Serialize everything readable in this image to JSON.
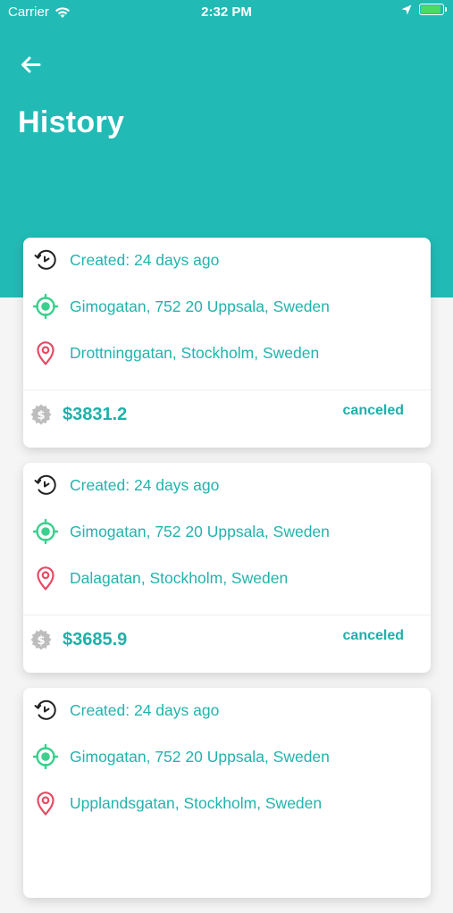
{
  "status_bar": {
    "carrier": "Carrier",
    "time": "2:32 PM"
  },
  "header": {
    "title": "History",
    "back_icon": "arrow-left-icon"
  },
  "colors": {
    "primary": "#22bab5",
    "accent_text": "#22b3ad",
    "origin_icon": "#3ccf8e",
    "destination_icon": "#e84a64",
    "coin_icon": "#bdbdbd"
  },
  "trips": [
    {
      "created": "Created: 24 days ago",
      "origin": "Gimogatan, 752 20 Uppsala, Sweden",
      "destination": "Drottninggatan, Stockholm, Sweden",
      "price": "$3831.2",
      "status": "canceled"
    },
    {
      "created": "Created: 24 days ago",
      "origin": "Gimogatan, 752 20 Uppsala, Sweden",
      "destination": "Dalagatan, Stockholm, Sweden",
      "price": "$3685.9",
      "status": "canceled"
    },
    {
      "created": "Created: 24 days ago",
      "origin": "Gimogatan, 752 20 Uppsala, Sweden",
      "destination": "Upplandsgatan, Stockholm, Sweden",
      "price": "",
      "status": ""
    }
  ]
}
